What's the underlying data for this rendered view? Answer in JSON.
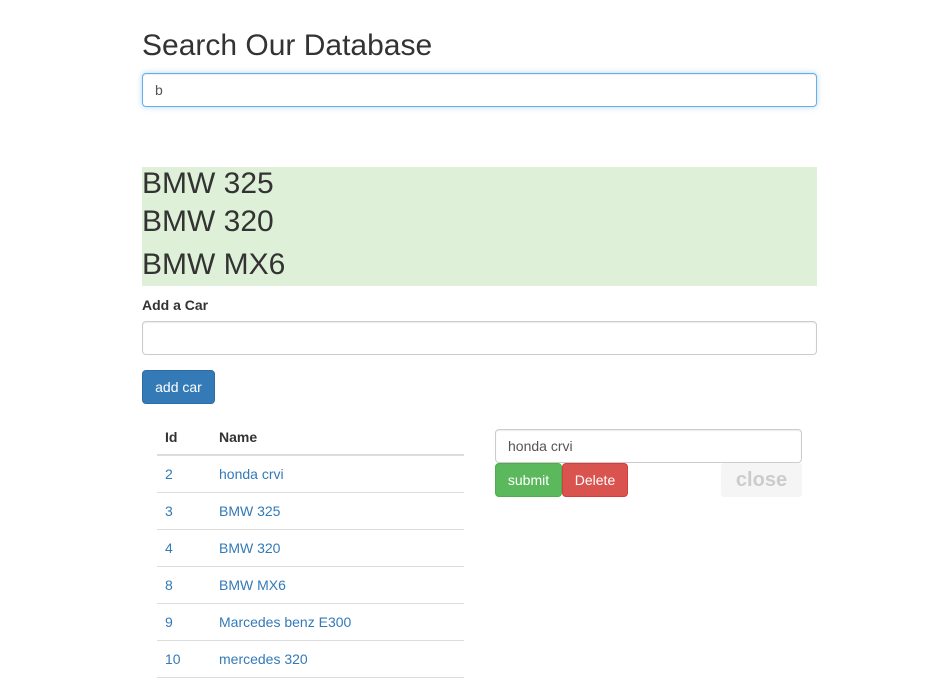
{
  "header": {
    "title": "Search Our Database"
  },
  "search": {
    "value": "b"
  },
  "results": [
    "BMW 325",
    "BMW 320",
    "BMW MX6"
  ],
  "add_car": {
    "label": "Add a Car",
    "value": "",
    "button_label": "add car"
  },
  "table": {
    "columns": [
      "Id",
      "Name"
    ],
    "rows": [
      {
        "id": "2",
        "name": "honda crvi"
      },
      {
        "id": "3",
        "name": "BMW 325"
      },
      {
        "id": "4",
        "name": "BMW 320"
      },
      {
        "id": "8",
        "name": "BMW MX6"
      },
      {
        "id": "9",
        "name": "Marcedes benz E300"
      },
      {
        "id": "10",
        "name": "mercedes 320"
      }
    ]
  },
  "edit": {
    "value": "honda crvi",
    "submit_label": "submit",
    "delete_label": "Delete",
    "close_label": "close"
  },
  "colors": {
    "primary": "#337ab7",
    "success": "#5cb85c",
    "danger": "#d9534f",
    "results_bg": "#dff0d8"
  }
}
